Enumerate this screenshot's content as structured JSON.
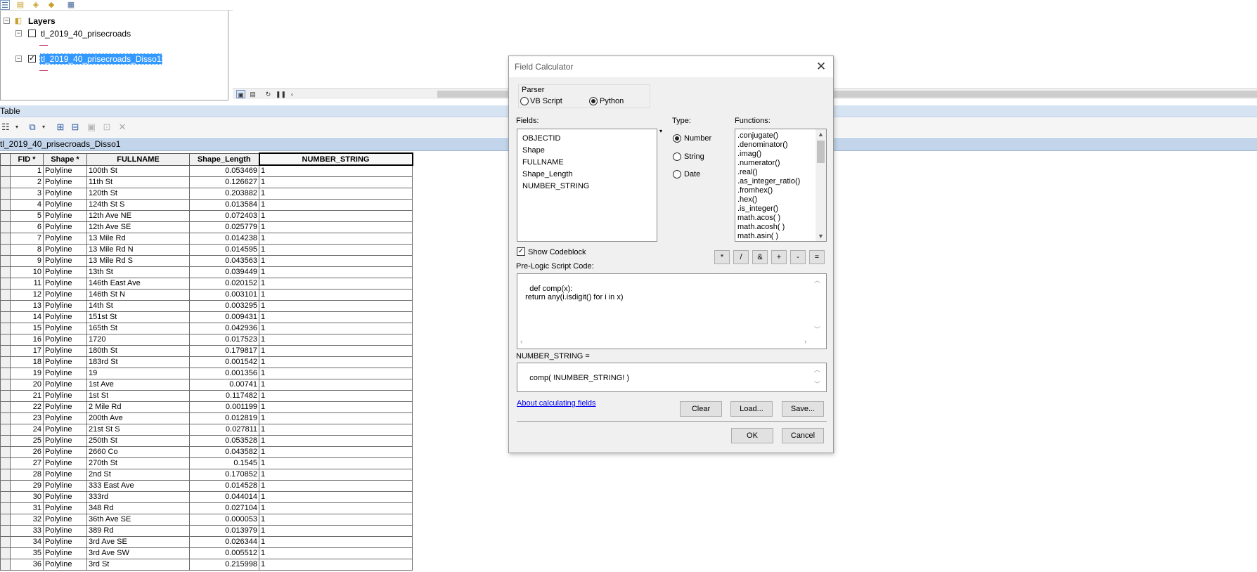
{
  "toc": {
    "root_label": "Layers",
    "layers": [
      {
        "name": "tl_2019_40_prisecroads",
        "checked": false,
        "selected": false
      },
      {
        "name": "tl_2019_40_prisecroads_Disso1",
        "checked": true,
        "selected": true
      }
    ],
    "expander_minus": "−",
    "check_mark": "✓"
  },
  "table_window": {
    "title": "Table",
    "layer_tab": "tl_2019_40_prisecroads_Disso1",
    "columns": [
      "FID *",
      "Shape *",
      "FULLNAME",
      "Shape_Length",
      "NUMBER_STRING"
    ],
    "rows": [
      [
        "1",
        "Polyline",
        "100th St",
        "0.053469",
        "1"
      ],
      [
        "2",
        "Polyline",
        "11th St",
        "0.126627",
        "1"
      ],
      [
        "3",
        "Polyline",
        "120th St",
        "0.203882",
        "1"
      ],
      [
        "4",
        "Polyline",
        "124th St S",
        "0.013584",
        "1"
      ],
      [
        "5",
        "Polyline",
        "12th Ave NE",
        "0.072403",
        "1"
      ],
      [
        "6",
        "Polyline",
        "12th Ave SE",
        "0.025779",
        "1"
      ],
      [
        "7",
        "Polyline",
        "13 Mile Rd",
        "0.014238",
        "1"
      ],
      [
        "8",
        "Polyline",
        "13 Mile Rd N",
        "0.014595",
        "1"
      ],
      [
        "9",
        "Polyline",
        "13 Mile Rd S",
        "0.043563",
        "1"
      ],
      [
        "10",
        "Polyline",
        "13th St",
        "0.039449",
        "1"
      ],
      [
        "11",
        "Polyline",
        "146th East Ave",
        "0.020152",
        "1"
      ],
      [
        "12",
        "Polyline",
        "146th St N",
        "0.003101",
        "1"
      ],
      [
        "13",
        "Polyline",
        "14th St",
        "0.003295",
        "1"
      ],
      [
        "14",
        "Polyline",
        "151st St",
        "0.009431",
        "1"
      ],
      [
        "15",
        "Polyline",
        "165th St",
        "0.042936",
        "1"
      ],
      [
        "16",
        "Polyline",
        "1720",
        "0.017523",
        "1"
      ],
      [
        "17",
        "Polyline",
        "180th St",
        "0.179817",
        "1"
      ],
      [
        "18",
        "Polyline",
        "183rd St",
        "0.001542",
        "1"
      ],
      [
        "19",
        "Polyline",
        "19",
        "0.001356",
        "1"
      ],
      [
        "20",
        "Polyline",
        "1st Ave",
        "0.00741",
        "1"
      ],
      [
        "21",
        "Polyline",
        "1st St",
        "0.117482",
        "1"
      ],
      [
        "22",
        "Polyline",
        "2 Mile Rd",
        "0.001199",
        "1"
      ],
      [
        "23",
        "Polyline",
        "200th Ave",
        "0.012819",
        "1"
      ],
      [
        "24",
        "Polyline",
        "21st St S",
        "0.027811",
        "1"
      ],
      [
        "25",
        "Polyline",
        "250th St",
        "0.053528",
        "1"
      ],
      [
        "26",
        "Polyline",
        "2660 Co",
        "0.043582",
        "1"
      ],
      [
        "27",
        "Polyline",
        "270th St",
        "0.1545",
        "1"
      ],
      [
        "28",
        "Polyline",
        "2nd St",
        "0.170852",
        "1"
      ],
      [
        "29",
        "Polyline",
        "333 East Ave",
        "0.014528",
        "1"
      ],
      [
        "30",
        "Polyline",
        "333rd",
        "0.044014",
        "1"
      ],
      [
        "31",
        "Polyline",
        "348 Rd",
        "0.027104",
        "1"
      ],
      [
        "32",
        "Polyline",
        "36th Ave SE",
        "0.000053",
        "1"
      ],
      [
        "33",
        "Polyline",
        "389 Rd",
        "0.013979",
        "1"
      ],
      [
        "34",
        "Polyline",
        "3rd Ave SE",
        "0.026344",
        "1"
      ],
      [
        "35",
        "Polyline",
        "3rd Ave SW",
        "0.005512",
        "1"
      ],
      [
        "36",
        "Polyline",
        "3rd St",
        "0.215998",
        "1"
      ]
    ]
  },
  "dialog": {
    "title": "Field Calculator",
    "close_glyph": "✕",
    "parser_label": "Parser",
    "parser_vbscript": "VB Script",
    "parser_python": "Python",
    "parser_selected": "Python",
    "fields_label": "Fields:",
    "fields": [
      "OBJECTID",
      "Shape",
      "FULLNAME",
      "Shape_Length",
      "NUMBER_STRING"
    ],
    "type_label": "Type:",
    "type_number": "Number",
    "type_string": "String",
    "type_date": "Date",
    "type_selected": "Number",
    "functions_label": "Functions:",
    "functions": [
      ".conjugate()",
      ".denominator()",
      ".imag()",
      ".numerator()",
      ".real()",
      ".as_integer_ratio()",
      ".fromhex()",
      ".hex()",
      ".is_integer()",
      "math.acos( )",
      "math.acosh( )",
      "math.asin( )"
    ],
    "show_codeblock_label": "Show Codeblock",
    "show_codeblock_checked": true,
    "operators": [
      "*",
      "/",
      "&",
      "+",
      "-",
      "="
    ],
    "prelogic_label": "Pre-Logic Script Code:",
    "prelogic_code": "def comp(x):\n  return any(i.isdigit() for i in x)",
    "expression_label": "NUMBER_STRING =",
    "expression": "comp( !NUMBER_STRING! )",
    "about_link": "About calculating fields",
    "clear_button": "Clear",
    "load_button": "Load...",
    "save_button": "Save...",
    "ok_button": "OK",
    "cancel_button": "Cancel"
  }
}
